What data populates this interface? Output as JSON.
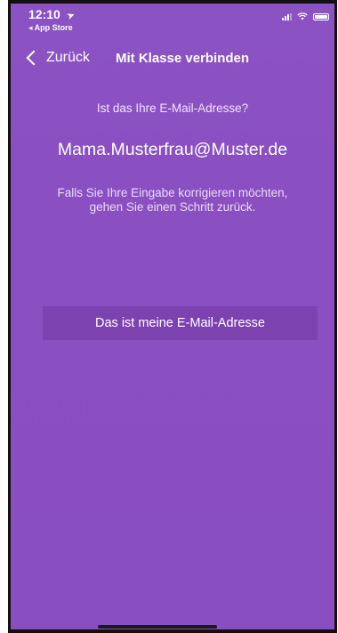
{
  "status_bar": {
    "time": "12:10",
    "location_glyph": "➤",
    "back_app": "◂ App Store"
  },
  "nav": {
    "back_label": "Zurück",
    "title": "Mit Klasse verbinden"
  },
  "content": {
    "question": "Ist das Ihre E-Mail-Adresse?",
    "email": "Mama.Musterfrau@Muster.de",
    "hint": "Falls Sie Ihre Eingabe korrigieren möchten, gehen Sie einen Schritt zurück.",
    "confirm_label": "Das ist meine E-Mail-Adresse"
  },
  "colors": {
    "background": "#8a4fc1",
    "button": "#7c42b0",
    "text": "#ffffff"
  }
}
